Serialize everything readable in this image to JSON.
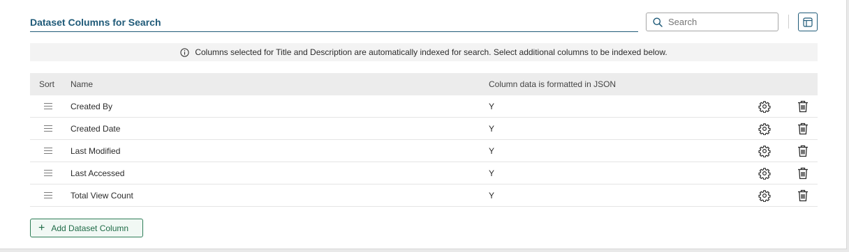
{
  "panel": {
    "title": "Dataset Columns for Search"
  },
  "search": {
    "placeholder": "Search",
    "value": ""
  },
  "info": {
    "message": "Columns selected for Title and Description are automatically indexed for search. Select additional columns to be indexed below."
  },
  "table": {
    "headers": {
      "sort": "Sort",
      "name": "Name",
      "json": "Column data is formatted in JSON"
    },
    "rows": [
      {
        "name": "Created By",
        "json": "Y"
      },
      {
        "name": "Created Date",
        "json": "Y"
      },
      {
        "name": "Last Modified",
        "json": "Y"
      },
      {
        "name": "Last Accessed",
        "json": "Y"
      },
      {
        "name": "Total View Count",
        "json": "Y"
      }
    ]
  },
  "actions": {
    "add_label": "Add Dataset Column"
  },
  "colors": {
    "accent": "#1f5a78",
    "add_button": "#2e7d57"
  },
  "icons": {
    "search": "search-icon",
    "layout": "layout-icon",
    "info": "info-icon",
    "drag": "drag-handle-icon",
    "settings": "gear-icon",
    "delete": "trash-icon",
    "add": "plus-icon"
  }
}
